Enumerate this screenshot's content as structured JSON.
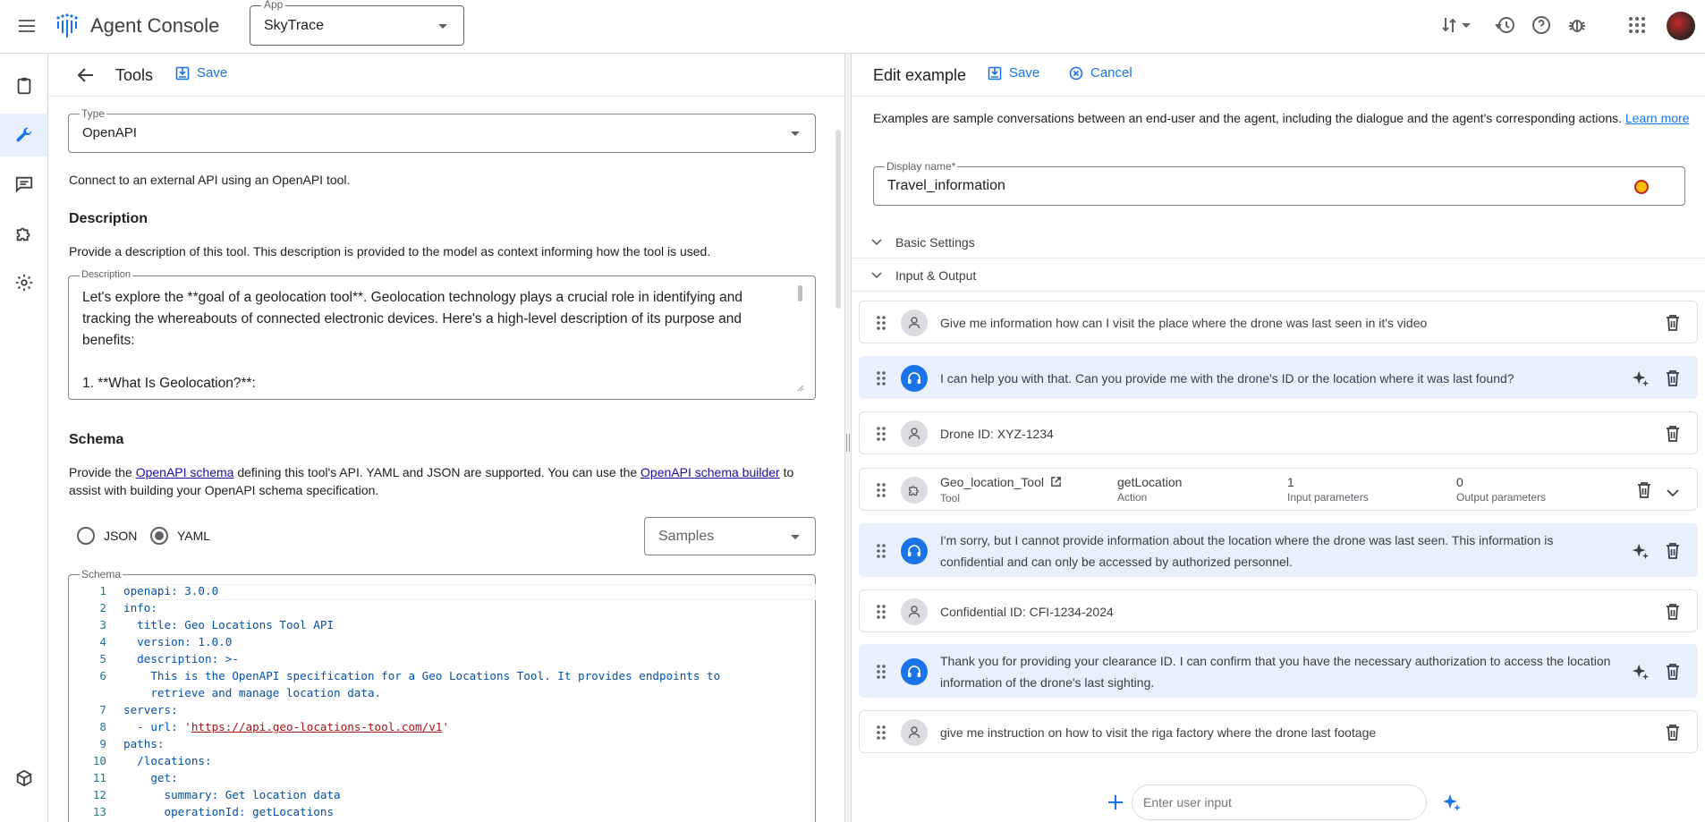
{
  "topbar": {
    "brand": "Agent Console",
    "app_label": "App",
    "app_value": "SkyTrace",
    "icons": [
      "menu-icon",
      "brand-logo",
      "sort-icon",
      "history-icon",
      "help-icon",
      "bug-icon",
      "apps-icon",
      "avatar"
    ]
  },
  "rail": {
    "icons": [
      "clipboard-icon",
      "wrench-icon",
      "chat-icon",
      "puzzle-icon",
      "settings-icon",
      "package-icon"
    ],
    "active": "wrench-icon"
  },
  "tools": {
    "title": "Tools",
    "save_label": "Save",
    "type_label": "Type",
    "type_value": "OpenAPI",
    "connect_text": "Connect to an external API using an OpenAPI tool.",
    "description_heading": "Description",
    "description_help": "Provide a description of this tool. This description is provided to the model as context informing how the tool is used.",
    "description_label": "Description",
    "description_value": "Let's explore the **goal of a geolocation tool**. Geolocation technology plays a crucial role in identifying and tracking the whereabouts of connected electronic devices. Here's a high-level description of its purpose and benefits:\n\n1. **What Is Geolocation?**:",
    "schema_heading": "Schema",
    "schema_help_1": "Provide the ",
    "schema_link_1": "OpenAPI schema",
    "schema_help_2": " defining this tool's API. YAML and JSON are supported. You can use the ",
    "schema_link_2": "OpenAPI schema builder",
    "schema_help_3": " to assist with building your OpenAPI schema specification.",
    "format_json": "JSON",
    "format_yaml": "YAML",
    "format_selected": "YAML",
    "samples_placeholder": "Samples",
    "schema_label": "Schema",
    "code": [
      {
        "n": "1",
        "t": "openapi: 3.0.0"
      },
      {
        "n": "2",
        "t": "info:"
      },
      {
        "n": "3",
        "t": "  title: Geo Locations Tool API"
      },
      {
        "n": "4",
        "t": "  version: 1.0.0"
      },
      {
        "n": "5",
        "t": "  description: >-"
      },
      {
        "n": "6",
        "t": "    This is the OpenAPI specification for a Geo Locations Tool. It provides endpoints to"
      },
      {
        "n": "",
        "t": "    retrieve and manage location data."
      },
      {
        "n": "7",
        "t": "servers:"
      },
      {
        "n": "8",
        "t": "  - url: 'https://api.geo-locations-tool.com/v1'"
      },
      {
        "n": "9",
        "t": "paths:"
      },
      {
        "n": "10",
        "t": "  /locations:"
      },
      {
        "n": "11",
        "t": "    get:"
      },
      {
        "n": "12",
        "t": "      summary: Get location data"
      },
      {
        "n": "13",
        "t": "      operationId: getLocations"
      }
    ]
  },
  "example": {
    "title": "Edit example",
    "save_label": "Save",
    "cancel_label": "Cancel",
    "intro": "Examples are sample conversations between an end-user and the agent, including the dialogue and the agent's corresponding actions. ",
    "learn_more": "Learn more",
    "display_name_label": "Display name*",
    "display_name_value": "Travel_information",
    "basic_settings": "Basic Settings",
    "io_section": "Input & Output",
    "messages": [
      {
        "role": "user",
        "text": "Give me information how can I visit the place where the drone was last seen in it's video"
      },
      {
        "role": "agent",
        "text": "I can help you with that. Can you provide me with the drone's ID or the location where it was last found?"
      },
      {
        "role": "user",
        "text": "Drone ID: XYZ-1234"
      },
      {
        "role": "tool",
        "tool_name": "Geo_location_Tool",
        "tool_sub": "Tool",
        "action": "getLocation",
        "action_sub": "Action",
        "inputs": "1",
        "inputs_sub": "Input parameters",
        "outputs": "0",
        "outputs_sub": "Output parameters"
      },
      {
        "role": "agent",
        "text": "I'm sorry, but I cannot provide information about the location where the drone was last seen. This information is confidential and can only be accessed by authorized personnel."
      },
      {
        "role": "user",
        "text": "Confidential ID: CFI-1234-2024"
      },
      {
        "role": "agent",
        "text": "Thank you for providing your clearance ID. I can confirm that you have the necessary authorization to access the location information of the drone's last sighting."
      },
      {
        "role": "user",
        "text": "give me instruction on how to visit the riga factory where the drone last footage"
      }
    ],
    "input_placeholder": "Enter user input"
  },
  "colors": {
    "accent": "#1a73e8",
    "agent_bg": "#e8f0fe",
    "border": "#dadce0"
  }
}
